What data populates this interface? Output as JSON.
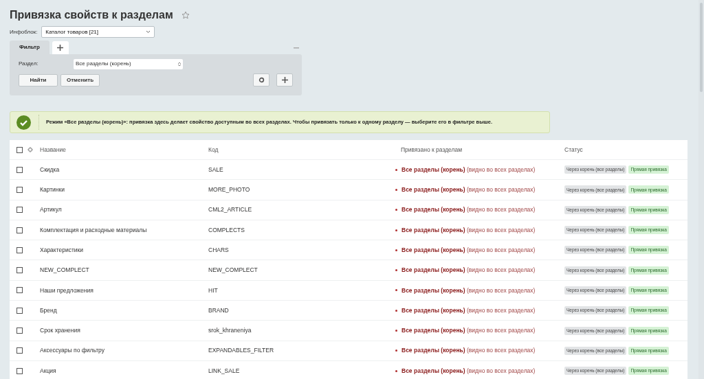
{
  "title": "Привязка свойств к разделам",
  "iblock": {
    "label": "Инфоблок:",
    "value": "Каталог товаров [21]"
  },
  "filter": {
    "tabs": [
      {
        "label": "Фильтр",
        "selected": true
      }
    ],
    "field_label": "Раздел:",
    "field_value": "Все разделы (корень)",
    "buttons": [
      "Найти",
      "Отменить"
    ]
  },
  "alert": {
    "text": "Режим «Все разделы (корень)»: привязка здесь делает свойство доступным во всех разделах. Чтобы привязать только к одному разделу — выберите его в фильтре выше."
  },
  "table": {
    "select_all_checked": false,
    "columns": [
      "Название",
      "Код",
      "Привязано к разделам",
      "Статус"
    ],
    "rows": [
      {
        "checked": false,
        "name": "Скидка",
        "code": "SALE",
        "bound": "**Все разделы (корень)** (видно во всех разделах)",
        "badges": [
          {
            "kind": "root",
            "text": "Через корень (все разделы)"
          },
          {
            "kind": "direct",
            "text": "Прямая привязка"
          }
        ]
      },
      {
        "checked": false,
        "name": "Картинки",
        "code": "MORE_PHOTO",
        "bound": "**Все разделы (корень)** (видно во всех разделах)",
        "badges": [
          {
            "kind": "root",
            "text": "Через корень (все разделы)"
          },
          {
            "kind": "direct",
            "text": "Прямая привязка"
          }
        ]
      },
      {
        "checked": false,
        "name": "Артикул",
        "code": "CML2_ARTICLE",
        "bound": "**Все разделы (корень)** (видно во всех разделах)",
        "badges": [
          {
            "kind": "root",
            "text": "Через корень (все разделы)"
          },
          {
            "kind": "direct",
            "text": "Прямая привязка"
          }
        ]
      },
      {
        "checked": false,
        "name": "Комплектация и расходные материалы",
        "code": "COMPLECTS",
        "bound": "**Все разделы (корень)** (видно во всех разделах)",
        "badges": [
          {
            "kind": "root",
            "text": "Через корень (все разделы)"
          },
          {
            "kind": "direct",
            "text": "Прямая привязка"
          }
        ]
      },
      {
        "checked": false,
        "name": "Характеристики",
        "code": "CHARS",
        "bound": "**Все разделы (корень)** (видно во всех разделах)",
        "badges": [
          {
            "kind": "root",
            "text": "Через корень (все разделы)"
          },
          {
            "kind": "direct",
            "text": "Прямая привязка"
          }
        ]
      },
      {
        "checked": false,
        "name": "NEW_COMPLECT",
        "code": "NEW_COMPLECT",
        "bound": "**Все разделы (корень)** (видно во всех разделах)",
        "badges": [
          {
            "kind": "root",
            "text": "Через корень (все разделы)"
          },
          {
            "kind": "direct",
            "text": "Прямая привязка"
          }
        ]
      },
      {
        "checked": false,
        "name": "Наши предложения",
        "code": "HIT",
        "bound": "**Все разделы (корень)** (видно во всех разделах)",
        "badges": [
          {
            "kind": "root",
            "text": "Через корень (все разделы)"
          },
          {
            "kind": "direct",
            "text": "Прямая привязка"
          }
        ]
      },
      {
        "checked": false,
        "name": "Бренд",
        "code": "BRAND",
        "bound": "**Все разделы (корень)** (видно во всех разделах)",
        "badges": [
          {
            "kind": "root",
            "text": "Через корень (все разделы)"
          },
          {
            "kind": "direct",
            "text": "Прямая привязка"
          }
        ]
      },
      {
        "checked": false,
        "name": "Срок хранения",
        "code": "srok_khraneniya",
        "bound": "**Все разделы (корень)** (видно во всех разделах)",
        "badges": [
          {
            "kind": "root",
            "text": "Через корень (все разделы)"
          },
          {
            "kind": "direct",
            "text": "Прямая привязка"
          }
        ]
      },
      {
        "checked": false,
        "name": "Аксессуары по фильтру",
        "code": "EXPANDABLES_FILTER",
        "bound": "**Все разделы (корень)** (видно во всех разделах)",
        "badges": [
          {
            "kind": "root",
            "text": "Через корень (все разделы)"
          },
          {
            "kind": "direct",
            "text": "Прямая привязка"
          }
        ]
      },
      {
        "checked": false,
        "name": "Акция",
        "code": "LINK_SALE",
        "bound": "**Все разделы (корень)** (видно во всех разделах)",
        "badges": [
          {
            "kind": "root",
            "text": "Через корень (все разделы)"
          },
          {
            "kind": "direct",
            "text": "Прямая привязка"
          }
        ]
      }
    ]
  }
}
